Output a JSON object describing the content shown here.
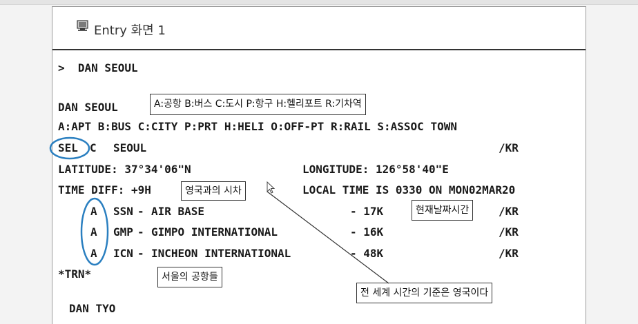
{
  "title": "Entry 화면 1",
  "command": ">  DAN SEOUL",
  "lines": {
    "header": "DAN SEOUL",
    "legend": "A:APT B:BUS C:CITY P:PRT H:HELI O:OFF-PT R:RAIL S:ASSOC TOWN",
    "city_code": "SEL",
    "city_type": "C",
    "city_name": "SEOUL",
    "country": "/KR",
    "latitude": "LATITUDE: 37°34'06\"N",
    "longitude": "LONGITUDE: 126°58'40\"E",
    "time_diff": "TIME DIFF: +9H",
    "local_time": "LOCAL TIME IS 0330 ON MON02MAR20",
    "trn": "*TRN*",
    "cut_line": "DAN TYO"
  },
  "airports": [
    {
      "type": "A",
      "code": "SSN",
      "name": "AIR BASE",
      "distance": "- 17K",
      "country": "/KR"
    },
    {
      "type": "A",
      "code": "GMP",
      "name": "GIMPO INTERNATIONAL",
      "distance": "- 16K",
      "country": "/KR"
    },
    {
      "type": "A",
      "code": "ICN",
      "name": "INCHEON INTERNATIONAL",
      "distance": "- 48K",
      "country": "/KR"
    }
  ],
  "annotations": {
    "type_legend": "A:공항 B:버스 C:도시 P:항구 H:헬리포트 R:기차역",
    "time_diff_note": "영국과의 시차",
    "current_datetime": "현재날짜시간",
    "seoul_airports": "서울의 공항들",
    "gmt_note": "전 세계 시간의 기준은 영국이다"
  },
  "colors": {
    "highlight_circle": "#2a7fc0",
    "terminal_text": "#1a1a1a"
  },
  "icons": {
    "title": "monitor-icon",
    "cursor": "mouse-cursor-icon"
  }
}
